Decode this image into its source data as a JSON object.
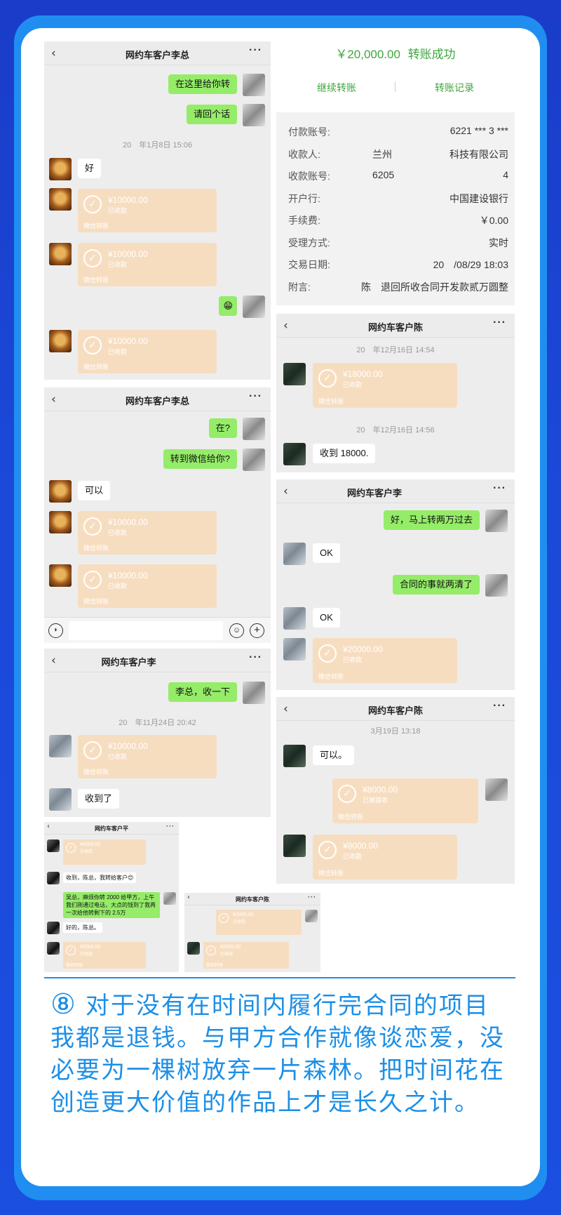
{
  "chats": {
    "c1": {
      "title": "网约车客户李总",
      "bubble1": "在这里给你转",
      "bubble2": "请回个话",
      "ts": "20　年1月8日 15:06",
      "reply": "好",
      "tr_amount": "¥10000.00",
      "tr_status": "已收款",
      "tr_footer": "微信转账",
      "emoji": "😁"
    },
    "c2": {
      "title": "网约车客户李总",
      "bubble1": "在?",
      "bubble2": "转到微信给你?",
      "reply": "可以",
      "tr_amount": "¥10000.00",
      "tr_status": "已收款",
      "tr_footer": "微信转账"
    },
    "c3": {
      "title": "网约车客户李",
      "bubble1": "李总，收一下",
      "ts": "20　年11月24日 20:42",
      "tr_amount": "¥10000.00",
      "tr_status": "已收款",
      "tr_footer": "微信转账",
      "reply": "收到了"
    },
    "c4": {
      "title": "网约车客户陈",
      "ts1": "20　年12月16日 14:54",
      "tr_amount": "¥18000.00",
      "tr_status": "已收款",
      "tr_footer": "微信转账",
      "ts2": "20　年12月16日 14:56",
      "reply": "收到 18000."
    },
    "c5": {
      "title": "网约车客户李",
      "bubble1": "好，马上转两万过去",
      "reply1": "OK",
      "bubble2": "合同的事就两清了",
      "reply2": "OK",
      "tr_amount": "¥20000.00",
      "tr_status": "已收款",
      "tr_footer": "微信转账"
    },
    "c6": {
      "title": "网约车客户陈",
      "ts": "3月19日 13:18",
      "reply": "可以。",
      "tr1_amount": "¥8000.00",
      "tr1_status": "已被接收",
      "tr_footer": "微信转账",
      "tr2_amount": "¥8000.00",
      "tr2_status": "已收款"
    },
    "c7": {
      "title": "网约车客户平",
      "tr1_amount": "¥3000.00",
      "tr1_status": "已收款",
      "msg1": "收到，陈总，我转给客户😊",
      "msg2": "吴总，麻烦你转 2000 给甲方，上午我们刚通过电话，大点的钱到了我再一次给他转剩下的 2.5万",
      "msg3": "好的，陈总。",
      "tr2_amount": "¥2000.00",
      "tr2_status": "已收款",
      "tr_footer": "微信转账"
    },
    "c8": {
      "title": "网约车客户陈",
      "tr1_amount": "¥2000.00",
      "tr1_status": "已收款",
      "tr2_amount": "¥2000.00",
      "tr2_status": "已收款",
      "tr_footer": "微信转账"
    }
  },
  "receipt": {
    "amount": "￥20,000.00",
    "status": "转账成功",
    "continue": "继续转账",
    "records": "转账记录",
    "rows": [
      {
        "k": "付款账号:",
        "m": "",
        "v": "6221 *** 3 ***"
      },
      {
        "k": "收款人:",
        "m": "兰州",
        "v": "科技有限公司"
      },
      {
        "k": "收款账号:",
        "m": "6205",
        "v": "4"
      },
      {
        "k": "开户行:",
        "m": "",
        "v": "中国建设银行"
      },
      {
        "k": "手续费:",
        "m": "",
        "v": "￥0.00"
      },
      {
        "k": "受理方式:",
        "m": "",
        "v": "实时"
      },
      {
        "k": "交易日期:",
        "m": "",
        "v": "20　/08/29 18:03"
      },
      {
        "k": "附言:",
        "m": "",
        "v": "陈　退回所收合同开发款贰万圆整"
      }
    ]
  },
  "caption": {
    "num": "⑧",
    "text": "对于没有在时间内履行完合同的项目我都是退钱。与甲方合作就像谈恋爱，没必要为一棵树放弃一片森林。把时间花在创造更大价值的作品上才是长久之计。"
  },
  "colors": {
    "accent": "#1d8fe6",
    "green_bubble": "#95ec69",
    "transfer": "#f7ddc0",
    "receipt_green": "#3fa63f"
  }
}
